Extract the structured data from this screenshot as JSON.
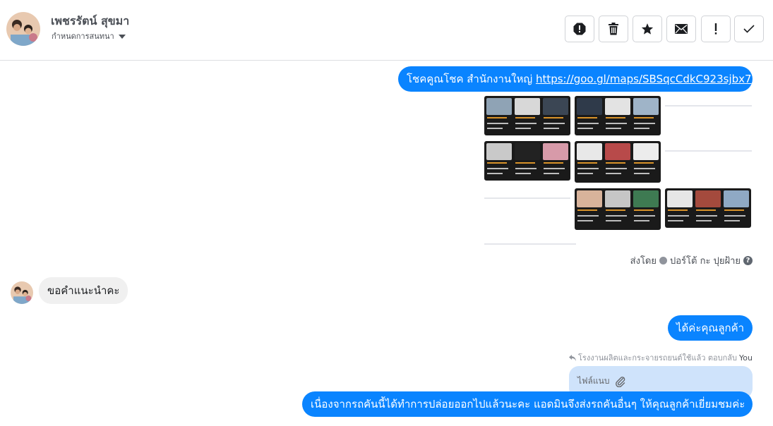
{
  "header": {
    "contact_name": "เพชรรัตน์ สุขมา",
    "assign_label": "กำหนดการสนทนา",
    "toolbar": [
      {
        "name": "spam-icon",
        "label": "spam"
      },
      {
        "name": "trash-icon",
        "label": "delete"
      },
      {
        "name": "star-icon",
        "label": "star"
      },
      {
        "name": "mail-icon",
        "label": "mark unread"
      },
      {
        "name": "exclamation-icon",
        "label": "follow up"
      },
      {
        "name": "check-icon",
        "label": "done"
      }
    ]
  },
  "messages": {
    "m1_text": "โชคคูณโชค สำนักงานใหญ่ ",
    "m1_link": "https://goo.gl/maps/SBSqcCdkC923sjbx7",
    "sent_by_prefix": "ส่งโดย",
    "sent_by_name": "ปอร์โต้ กะ ปุยฝ้าย",
    "m2_text": "ขอคำแนะนำคะ",
    "m3_text": "ได้ค่ะคุณลูกค้า",
    "reply_meta_text": "โรงงานผลิตและกระจายรถยนต์ใช้แล้ว ตอบกลับ",
    "reply_meta_owner": "You",
    "attachment_label": "ไฟล์แนบ",
    "m4_text": "เนื่องจากรถคันนี้ได้ทำการปล่อยออกไปแล้วนะคะ แอดมินจึงส่งรถคันอื่นๆ ให้คุณลูกค้าเยี่ยมชมค่ะ"
  },
  "colors": {
    "accent": "#0a84ff",
    "incoming_bubble": "#f0f0f0",
    "attachment_bg": "#cfe3fb"
  }
}
